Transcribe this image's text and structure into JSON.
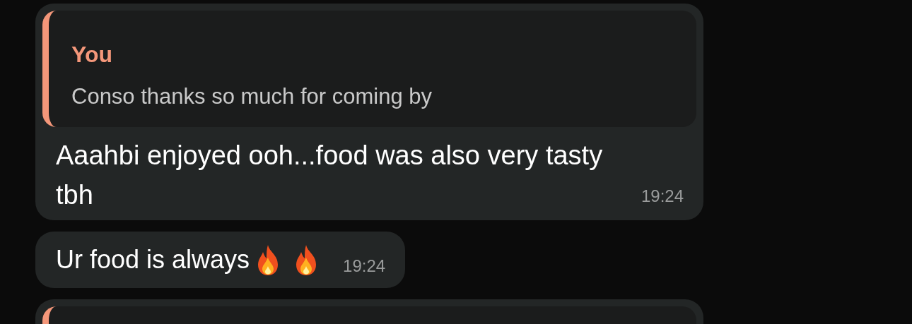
{
  "messages": [
    {
      "kind": "reply",
      "quote": {
        "author": "You",
        "text": "Conso thanks so much for coming by"
      },
      "text": "Aaahbi enjoyed ooh...food was also very tasty tbh",
      "time": "19:24"
    },
    {
      "kind": "text",
      "text": "Ur food is always",
      "emojis": [
        {
          "kind": "fire"
        },
        {
          "kind": "fire"
        }
      ],
      "time": "19:24"
    },
    {
      "kind": "reply_cut"
    }
  ]
}
